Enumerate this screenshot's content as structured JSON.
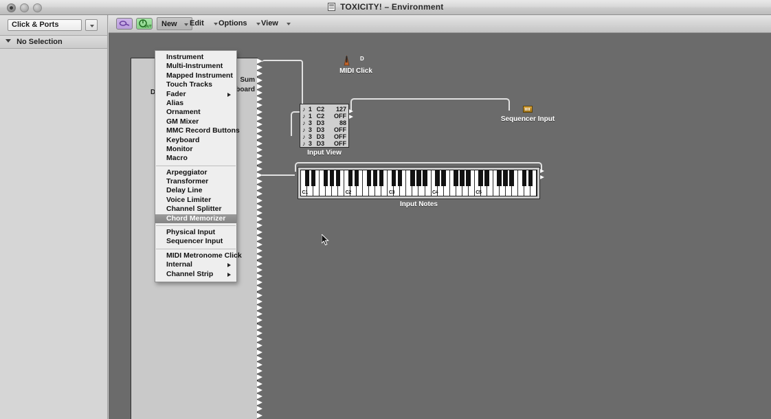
{
  "window": {
    "title": "TOXICITY! – Environment",
    "title_icon": "document-icon",
    "controls": [
      "close-button",
      "minimize-button",
      "zoom-button"
    ]
  },
  "inspector": {
    "layer_popup_value": "Click & Ports",
    "layer_popup_icon": "chevron-down-icon",
    "selection_label": "No Selection",
    "disclosure_icon": "disclosure-triangle-icon"
  },
  "toolbar": {
    "cable_button_icon": "cable-tool-icon",
    "out_button_icon": "out-knob-icon",
    "menus": [
      {
        "label": "New",
        "active": true
      },
      {
        "label": "Edit",
        "active": false
      },
      {
        "label": "Options",
        "active": false
      },
      {
        "label": "View",
        "active": false
      }
    ]
  },
  "new_menu": {
    "groups": [
      {
        "items": [
          {
            "label": "Instrument",
            "submenu": false,
            "selected": false
          },
          {
            "label": "Multi-Instrument",
            "submenu": false,
            "selected": false
          },
          {
            "label": "Mapped Instrument",
            "submenu": false,
            "selected": false
          },
          {
            "label": "Touch Tracks",
            "submenu": false,
            "selected": false
          },
          {
            "label": "Fader",
            "submenu": true,
            "selected": false
          },
          {
            "label": "Alias",
            "submenu": false,
            "selected": false
          },
          {
            "label": "Ornament",
            "submenu": false,
            "selected": false
          },
          {
            "label": "GM Mixer",
            "submenu": false,
            "selected": false
          },
          {
            "label": "MMC Record Buttons",
            "submenu": false,
            "selected": false
          },
          {
            "label": "Keyboard",
            "submenu": false,
            "selected": false
          },
          {
            "label": "Monitor",
            "submenu": false,
            "selected": false
          },
          {
            "label": "Macro",
            "submenu": false,
            "selected": false
          }
        ]
      },
      {
        "items": [
          {
            "label": "Arpeggiator",
            "submenu": false,
            "selected": false
          },
          {
            "label": "Transformer",
            "submenu": false,
            "selected": false
          },
          {
            "label": "Delay Line",
            "submenu": false,
            "selected": false
          },
          {
            "label": "Voice Limiter",
            "submenu": false,
            "selected": false
          },
          {
            "label": "Channel Splitter",
            "submenu": false,
            "selected": false
          },
          {
            "label": "Chord Memorizer",
            "submenu": false,
            "selected": true
          }
        ]
      },
      {
        "items": [
          {
            "label": "Physical Input",
            "submenu": false,
            "selected": false
          },
          {
            "label": "Sequencer Input",
            "submenu": false,
            "selected": false
          }
        ]
      },
      {
        "items": [
          {
            "label": "MIDI Metronome Click",
            "submenu": false,
            "selected": false
          },
          {
            "label": "Internal",
            "submenu": true,
            "selected": false
          },
          {
            "label": "Channel Strip",
            "submenu": true,
            "selected": false
          }
        ]
      }
    ]
  },
  "canvas": {
    "physical_input": {
      "label_left": "DS",
      "label_right_1": "Sum",
      "label_right_2": "yboard",
      "port_count": 58
    },
    "midi_click": {
      "label": "MIDI Click",
      "icon": "metronome-icon",
      "port_glyph": "D"
    },
    "input_view": {
      "label": "Input View",
      "rows": [
        {
          "note_icon": "♪",
          "channel": "1",
          "pitch": "C2",
          "value": "127"
        },
        {
          "note_icon": "♪",
          "channel": "1",
          "pitch": "C2",
          "value": "OFF"
        },
        {
          "note_icon": "♪",
          "channel": "3",
          "pitch": "D3",
          "value": "88"
        },
        {
          "note_icon": "♪",
          "channel": "3",
          "pitch": "D3",
          "value": "OFF"
        },
        {
          "note_icon": "♪",
          "channel": "3",
          "pitch": "D3",
          "value": "OFF"
        },
        {
          "note_icon": "♪",
          "channel": "3",
          "pitch": "D3",
          "value": "OFF"
        }
      ]
    },
    "sequencer_input": {
      "label": "Sequencer Input",
      "icon": "sequencer-input-icon"
    },
    "keyboard": {
      "label": "Input Notes",
      "octave_labels": [
        "C1",
        "C2",
        "C3",
        "C4",
        "C5"
      ],
      "octave_count": 5
    }
  },
  "cursor": {
    "icon": "arrow-cursor"
  },
  "colors": {
    "canvas_bg": "#6b6b6b",
    "object_fill": "#c9c9c9",
    "cable": "#e2e2e2",
    "menu_highlight": "#8f8f8f",
    "cable_tool": "#c2a9e2",
    "out_tool": "#96dd96"
  }
}
